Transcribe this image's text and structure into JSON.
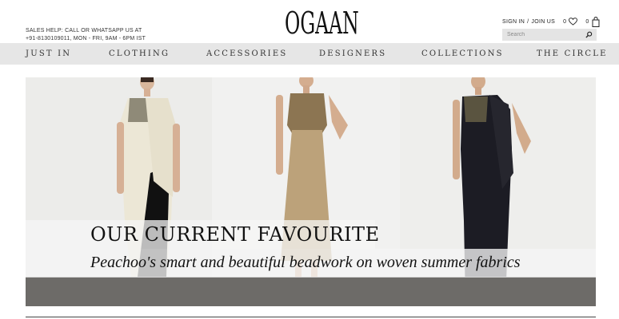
{
  "header": {
    "sales_line1": "SALES HELP: CALL OR WHATSAPP US AT",
    "sales_line2": "+91-8130109011, MON - FRI, 9AM - 6PM IST",
    "logo": "OGAAN",
    "sign_in": "SIGN IN",
    "separator": "/",
    "join_us": "JOIN US",
    "wishlist_count": "0",
    "cart_count": "0",
    "search_placeholder": "Search"
  },
  "nav": {
    "items": [
      "JUST IN",
      "CLOTHING",
      "ACCESSORIES",
      "DESIGNERS",
      "COLLECTIONS",
      "THE CIRCLE"
    ]
  },
  "hero": {
    "title": "OUR CURRENT FAVOURITE",
    "subtitle": "Peachoo's smart and beautiful beadwork on woven summer fabrics"
  },
  "colors": {
    "nav_bg": "#e6e6e6",
    "search_bg": "#e4e4e4",
    "ivory_saree": "#ece7d6",
    "gold_dress": "#b9a07a",
    "black_saree": "#1c1c24"
  }
}
